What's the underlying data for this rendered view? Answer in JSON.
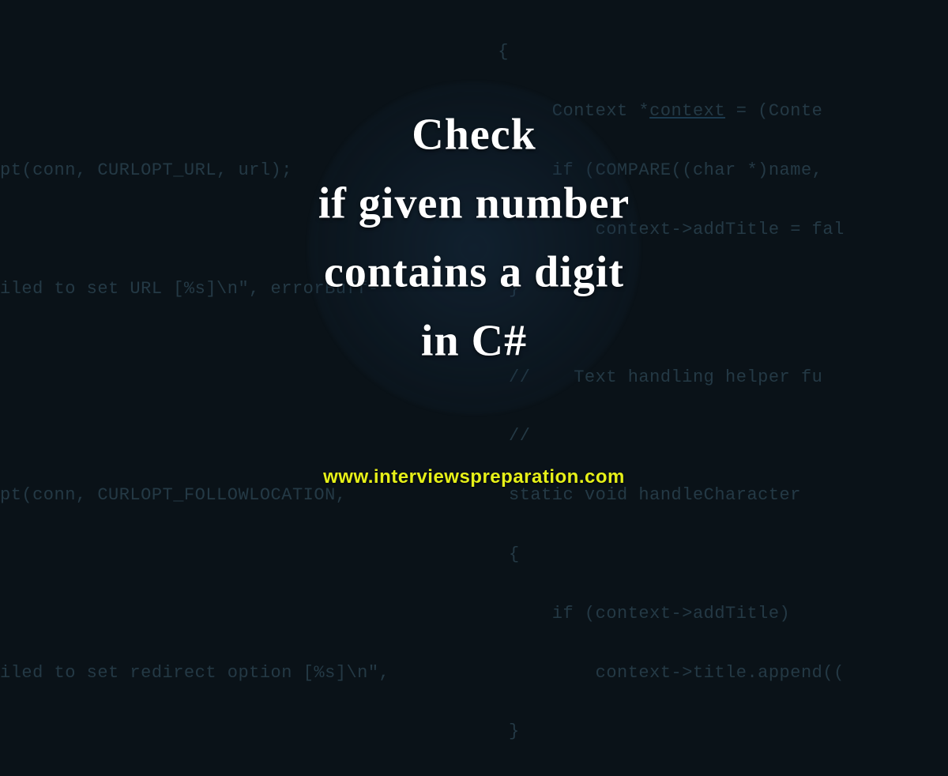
{
  "title": {
    "line1": "Check",
    "line2": "if given number",
    "line3": "contains a digit",
    "line4": "in C#"
  },
  "site_url": "www.interviewspreparation.com",
  "background_code": {
    "l1": "                                              {",
    "l2": "                                                   Context *context = (Conte",
    "l3": "pt(conn, CURLOPT_URL, url);                        if (COMPARE((char *)name,",
    "l4": "                                                       context->addTitle = fal",
    "l5": "iled to set URL [%s]\\n\", errorBuff-            }",
    "l6": "",
    "l7": "                                               //    Text handling helper fu",
    "l8": "                                               //",
    "l9": "pt(conn, CURLOPT_FOLLOWLOCATION,               static void handleCharacter",
    "l10": "                                               {",
    "l11": "                                                   if (context->addTitle)",
    "l12": "iled to set redirect option [%s]\\n\",                   context->title.append((",
    "l13": "                                               }"
  }
}
